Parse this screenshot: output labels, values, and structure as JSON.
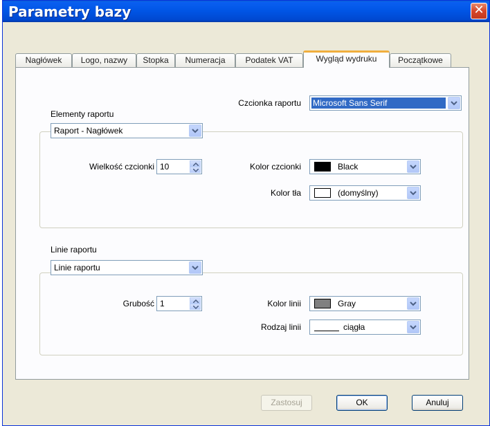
{
  "window": {
    "title": "Parametry bazy",
    "close_label": "✕"
  },
  "tabs": [
    {
      "label": "Nagłówek"
    },
    {
      "label": "Logo, nazwy"
    },
    {
      "label": "Stopka"
    },
    {
      "label": "Numeracja"
    },
    {
      "label": "Podatek VAT"
    },
    {
      "label": "Wygląd wydruku"
    },
    {
      "label": "Początkowe"
    }
  ],
  "active_tab": "Wygląd wydruku",
  "report_font": {
    "label": "Czcionka raportu",
    "value": "Microsoft Sans Serif"
  },
  "elements": {
    "label": "Elementy raportu",
    "selected": "Raport - Nagłówek",
    "font_size_label": "Wielkość czcionki",
    "font_size": "10",
    "font_color_label": "Kolor czcionki",
    "font_color": "Black",
    "font_color_hex": "#000000",
    "bg_color_label": "Kolor tła",
    "bg_color": "(domyślny)",
    "bg_color_hex": "#ffffff"
  },
  "lines": {
    "label": "Linie raportu",
    "selected": "Linie raportu",
    "thickness_label": "Grubość",
    "thickness": "1",
    "line_color_label": "Kolor linii",
    "line_color": "Gray",
    "line_color_hex": "#808080",
    "line_type_label": "Rodzaj linii",
    "line_type": "ciągła"
  },
  "buttons": {
    "apply": "Zastosuj",
    "ok": "OK",
    "cancel": "Anuluj"
  }
}
